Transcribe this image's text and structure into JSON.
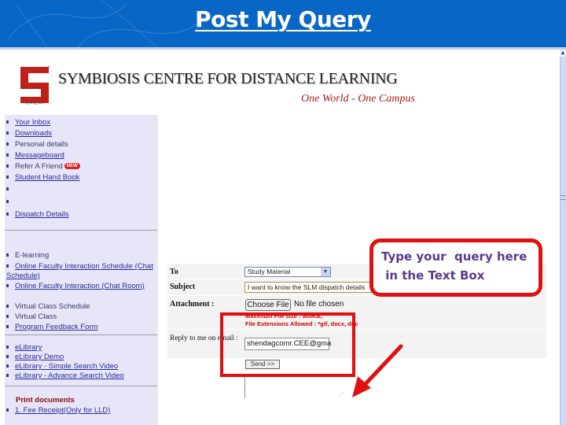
{
  "slide": {
    "title": "Post My Query",
    "header_color": "#0866c6"
  },
  "brand": {
    "name": "SYMBIOSIS CENTRE FOR DISTANCE LEARNING",
    "tagline": "One World - One Campus",
    "logo_caption": "वसुधैव कुटुम्बकम्",
    "accent_color": "#c0201a"
  },
  "sidebar": {
    "group1": [
      {
        "label": "Your Inbox",
        "link": true
      },
      {
        "label": "Downloads",
        "link": true
      },
      {
        "label": "Personal details",
        "link": false
      },
      {
        "label": "Messageboard",
        "link": true
      },
      {
        "label": "Refer A Friend",
        "link": false,
        "badge": "NEW"
      },
      {
        "label": "Student Hand Book",
        "link": true
      },
      {
        "label": "",
        "link": false
      },
      {
        "label": "",
        "link": false
      },
      {
        "label": "Dispatch Details",
        "link": true
      }
    ],
    "elearning_heading": "E-learning",
    "group2": [
      {
        "label": "Online Faculty Interaction Schedule (Chat Schedule)",
        "link": true
      },
      {
        "label": "Online Faculty Interaction (Chat Room)",
        "link": true
      },
      {
        "label": "Virtual Class Schedule",
        "link": false
      },
      {
        "label": "Virtual Class",
        "link": false
      },
      {
        "label": "Program Feedback Form",
        "link": true
      }
    ],
    "group3": [
      {
        "label": "eLibrary",
        "link": true
      },
      {
        "label": "eLibrary Demo",
        "link": true
      },
      {
        "label": "eLibrary - Simple Search Video",
        "link": true
      },
      {
        "label": "eLibrary - Advance Search Video",
        "link": true
      }
    ],
    "print_heading": "Print documents",
    "group4": [
      {
        "label": "1. Fee Receipt(Only for LLD)",
        "link": true
      }
    ]
  },
  "form": {
    "to_label": "To",
    "to_value": "Study Material",
    "subject_label": "Subject",
    "subject_value": "I want to know the SLM dispatch details",
    "attachment_label": "Attachment :",
    "choose_file_label": "Choose File",
    "no_file_text": "No file chosen",
    "max_size_note": "Maximum File size : 500KB,",
    "extensions_note": "File Extensions Allowed : *gif, docx, doc",
    "reply_label": "Reply to me on email :",
    "reply_value": "shendagcomr.CEE@gma",
    "send_label": "Send >>",
    "query_value": ""
  },
  "annotation": {
    "callout_text": "Type your  query here\n in the Text Box",
    "highlight_color": "#e01010",
    "text_color": "#5b3a8c"
  }
}
